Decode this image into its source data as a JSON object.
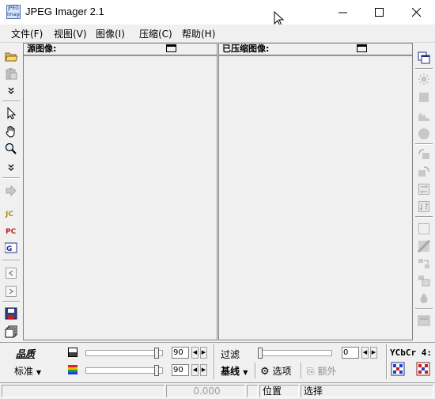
{
  "window": {
    "title": "JPEG Imager 2.1",
    "logo_text": "JPEG Imager"
  },
  "menu": [
    {
      "label": "文件(F)"
    },
    {
      "label": "视图(V)"
    },
    {
      "label": "图像(I)"
    },
    {
      "label": "压缩(C)"
    },
    {
      "label": "帮助(H)"
    }
  ],
  "panes": {
    "source_title": "源图像:",
    "compressed_title": "已压缩图像:"
  },
  "bottom": {
    "quality_label": "品质",
    "preset_label": "标准",
    "quality_value": "90",
    "quality2_value": "90",
    "filter_label": "过滤",
    "filter_value": "0",
    "baseline_label": "基线",
    "options_label": "选项",
    "extra_label": "额外",
    "colorspace_label": "YCbCr 4:"
  },
  "status": {
    "ratio": "0.000",
    "position": "位置",
    "select": "选择"
  },
  "colors": {
    "chrome": "#f0f0f0",
    "title_bg": "#ffffff",
    "border": "#808080"
  }
}
